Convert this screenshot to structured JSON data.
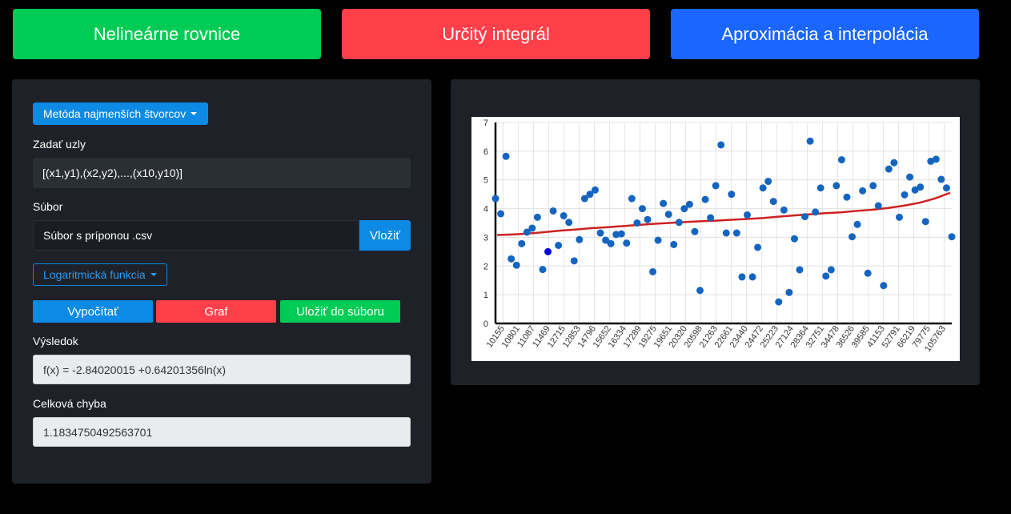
{
  "nav": {
    "nonlinear": "Nelineárne rovnice",
    "integral": "Určitý integrál",
    "approx": "Aproximácia a interpolácia"
  },
  "form": {
    "method_dropdown": "Metóda najmenších štvorcov",
    "nodes_label": "Zadať uzly",
    "nodes_value": "[(x1,y1),(x2,y2),...,(x10,y10)]",
    "file_label": "Súbor",
    "file_placeholder": "Súbor s príponou .csv",
    "insert_button": "Vložiť",
    "function_dropdown": "Logaritmická funkcia",
    "calc_button": "Vypočítať",
    "graph_button": "Graf",
    "save_button": "Uložiť do súboru",
    "result_label": "Výsledok",
    "result_value": "f(x) = -2.84020015 +0.64201356ln(x)",
    "error_label": "Celková chyba",
    "error_value": "1.1834750492563701"
  },
  "colors": {
    "green": "#00cc55",
    "red": "#ff3f4a",
    "blue": "#1a66ff",
    "accent": "#0d8ae3",
    "point": "#1565c0",
    "line": "#cc2222"
  },
  "chart_data": {
    "type": "scatter",
    "ylim": [
      0,
      7
    ],
    "yticks": [
      0,
      1,
      2,
      3,
      4,
      5,
      6,
      7
    ],
    "xtick_labels": [
      "10155",
      "10801",
      "11087",
      "11469",
      "12715",
      "12853",
      "14796",
      "15652",
      "16334",
      "17289",
      "19275",
      "19651",
      "20320",
      "20598",
      "21263",
      "22661",
      "23440",
      "24472",
      "25223",
      "27124",
      "28364",
      "32751",
      "34478",
      "36526",
      "39585",
      "41153",
      "52791",
      "66219",
      "79775",
      "105763"
    ],
    "points": [
      4.35,
      3.82,
      5.82,
      2.25,
      2.03,
      2.78,
      3.18,
      3.32,
      3.7,
      1.88,
      2.5,
      3.92,
      2.72,
      3.75,
      3.52,
      2.18,
      2.92,
      4.35,
      4.5,
      4.65,
      3.15,
      2.9,
      2.78,
      3.1,
      3.12,
      2.8,
      4.35,
      3.5,
      4.0,
      3.62,
      1.8,
      2.9,
      4.18,
      3.8,
      2.75,
      3.52,
      4.0,
      4.15,
      3.2,
      1.15,
      4.32,
      3.68,
      4.8,
      6.22,
      3.15,
      4.5,
      3.15,
      1.62,
      3.78,
      1.62,
      2.65,
      4.72,
      4.95,
      4.25,
      0.75,
      3.95,
      1.08,
      2.95,
      1.87,
      3.72,
      6.35,
      3.88,
      4.72,
      1.65,
      1.87,
      4.8,
      5.7,
      4.4,
      3.02,
      3.45,
      4.62,
      1.75,
      4.8,
      4.1,
      1.32,
      5.38,
      5.6,
      3.7,
      4.48,
      5.1,
      4.65,
      4.75,
      3.55,
      5.65,
      5.72,
      5.02,
      4.72,
      3.02
    ],
    "highlight_index": 10,
    "fit_curve": [
      3.08,
      3.1,
      3.13,
      3.18,
      3.23,
      3.27,
      3.32,
      3.35,
      3.39,
      3.43,
      3.47,
      3.5,
      3.53,
      3.56,
      3.58,
      3.61,
      3.64,
      3.67,
      3.72,
      3.76,
      3.8,
      3.84,
      3.87,
      3.92,
      3.96,
      4.02,
      4.1,
      4.2,
      4.35,
      4.55
    ]
  }
}
